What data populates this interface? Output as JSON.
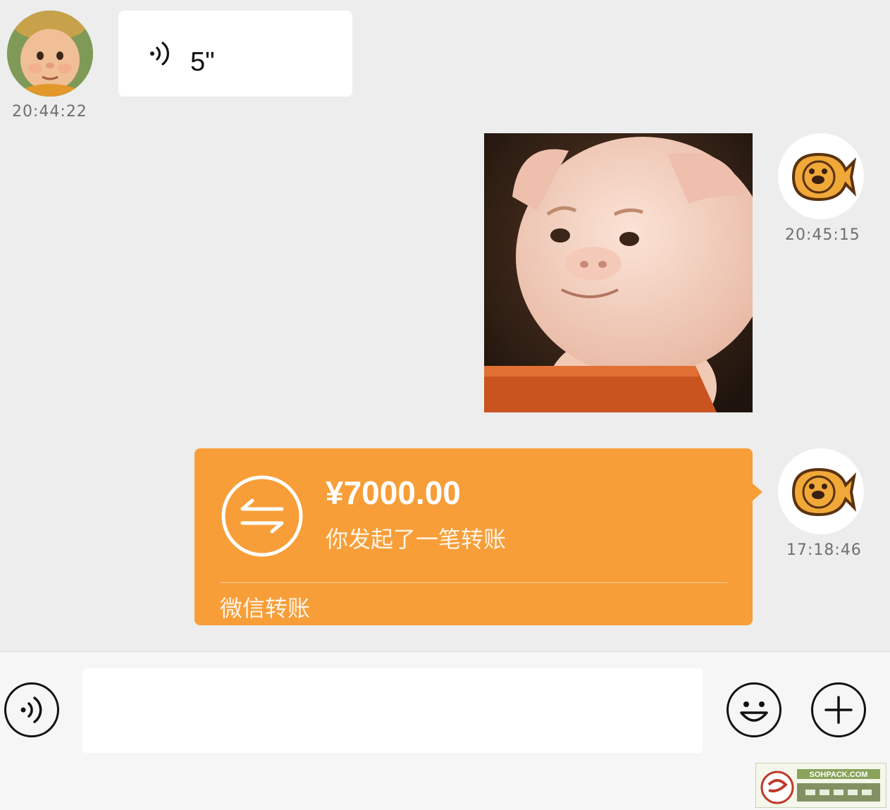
{
  "messages": [
    {
      "side": "left",
      "type": "voice",
      "duration": "5\"",
      "time": "20:44:22"
    },
    {
      "side": "right",
      "type": "sticker",
      "time": "20:45:15"
    },
    {
      "side": "right",
      "type": "transfer",
      "amount": "¥7000.00",
      "description": "你发起了一笔转账",
      "footer": "微信转账",
      "time": "17:18:46",
      "color": "#f79e39"
    }
  ],
  "input_bar": {
    "text_value": "",
    "voice_icon": "voice-icon",
    "emoji_icon": "emoji-icon",
    "plus_icon": "plus-icon"
  },
  "watermark": {
    "site": "SOHPACK.COM"
  }
}
